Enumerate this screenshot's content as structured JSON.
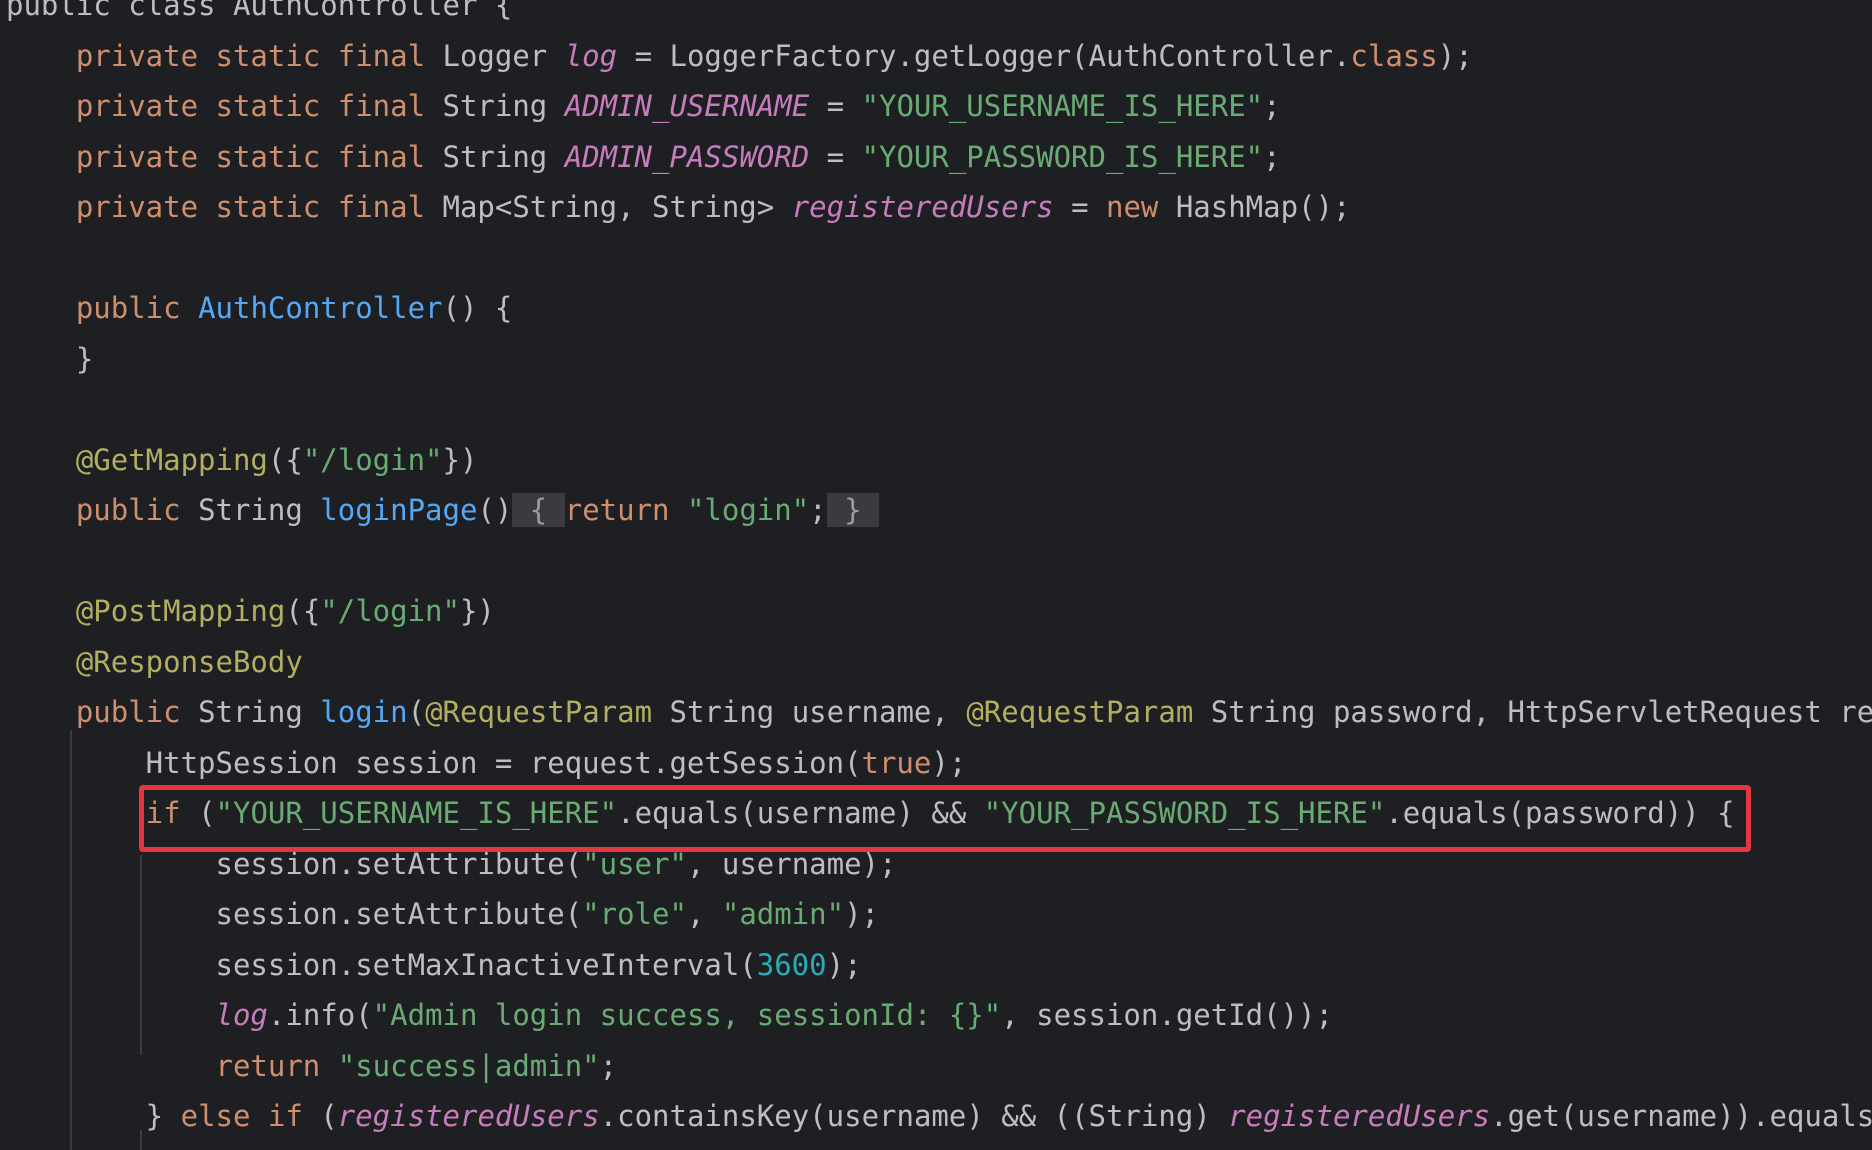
{
  "code": {
    "lines": [
      [
        {
          "t": "public class AuthController {",
          "c": "plain"
        }
      ],
      [
        {
          "t": "    private static final ",
          "c": "kw"
        },
        {
          "t": "Logger ",
          "c": "plain"
        },
        {
          "t": "log",
          "c": "fld"
        },
        {
          "t": " = LoggerFactory.getLogger(AuthController.",
          "c": "plain"
        },
        {
          "t": "class",
          "c": "kw"
        },
        {
          "t": ");",
          "c": "plain"
        }
      ],
      [
        {
          "t": "    private static final ",
          "c": "kw"
        },
        {
          "t": "String ",
          "c": "plain"
        },
        {
          "t": "ADMIN_USERNAME",
          "c": "fld"
        },
        {
          "t": " = ",
          "c": "plain"
        },
        {
          "t": "\"YOUR_USERNAME_IS_HERE\"",
          "c": "str"
        },
        {
          "t": ";",
          "c": "plain"
        }
      ],
      [
        {
          "t": "    private static final ",
          "c": "kw"
        },
        {
          "t": "String ",
          "c": "plain"
        },
        {
          "t": "ADMIN_PASSWORD",
          "c": "fld"
        },
        {
          "t": " = ",
          "c": "plain"
        },
        {
          "t": "\"YOUR_PASSWORD_IS_HERE\"",
          "c": "str"
        },
        {
          "t": ";",
          "c": "plain"
        }
      ],
      [
        {
          "t": "    private static final ",
          "c": "kw"
        },
        {
          "t": "Map<String, String> ",
          "c": "plain"
        },
        {
          "t": "registeredUsers",
          "c": "fld"
        },
        {
          "t": " = ",
          "c": "plain"
        },
        {
          "t": "new ",
          "c": "kw"
        },
        {
          "t": "HashMap();",
          "c": "plain"
        }
      ],
      [],
      [
        {
          "t": "    public ",
          "c": "kw"
        },
        {
          "t": "AuthController",
          "c": "fn"
        },
        {
          "t": "() {",
          "c": "plain"
        }
      ],
      [
        {
          "t": "    }",
          "c": "plain"
        }
      ],
      [],
      [
        {
          "t": "    @GetMapping",
          "c": "anno"
        },
        {
          "t": "({",
          "c": "plain"
        },
        {
          "t": "\"/login\"",
          "c": "str"
        },
        {
          "t": "})",
          "c": "plain"
        }
      ],
      [
        {
          "t": "    public ",
          "c": "kw"
        },
        {
          "t": "String ",
          "c": "plain"
        },
        {
          "t": "loginPage",
          "c": "fn"
        },
        {
          "t": "()",
          "c": "plain"
        },
        {
          "t": " { ",
          "c": "fold"
        },
        {
          "t": "return ",
          "c": "kw"
        },
        {
          "t": "\"login\"",
          "c": "str"
        },
        {
          "t": ";",
          "c": "plain"
        },
        {
          "t": " } ",
          "c": "fold"
        }
      ],
      [],
      [
        {
          "t": "    @PostMapping",
          "c": "anno"
        },
        {
          "t": "({",
          "c": "plain"
        },
        {
          "t": "\"/login\"",
          "c": "str"
        },
        {
          "t": "})",
          "c": "plain"
        }
      ],
      [
        {
          "t": "    @ResponseBody",
          "c": "anno"
        }
      ],
      [
        {
          "t": "    public ",
          "c": "kw"
        },
        {
          "t": "String ",
          "c": "plain"
        },
        {
          "t": "login",
          "c": "fn"
        },
        {
          "t": "(",
          "c": "plain"
        },
        {
          "t": "@RequestParam ",
          "c": "anno"
        },
        {
          "t": "String username, ",
          "c": "plain"
        },
        {
          "t": "@RequestParam ",
          "c": "anno"
        },
        {
          "t": "String password, HttpServletRequest re",
          "c": "plain"
        }
      ],
      [
        {
          "t": "        HttpSession session = request.getSession(",
          "c": "plain"
        },
        {
          "t": "true",
          "c": "kw"
        },
        {
          "t": ");",
          "c": "plain"
        }
      ],
      [
        {
          "t": "        if ",
          "c": "kw"
        },
        {
          "t": "(",
          "c": "plain"
        },
        {
          "t": "\"YOUR_USERNAME_IS_HERE\"",
          "c": "str"
        },
        {
          "t": ".equals(username) && ",
          "c": "plain"
        },
        {
          "t": "\"YOUR_PASSWORD_IS_HERE\"",
          "c": "str"
        },
        {
          "t": ".equals(password)) {",
          "c": "plain"
        }
      ],
      [
        {
          "t": "            session.setAttribute(",
          "c": "plain"
        },
        {
          "t": "\"user\"",
          "c": "str"
        },
        {
          "t": ", username);",
          "c": "plain"
        }
      ],
      [
        {
          "t": "            session.setAttribute(",
          "c": "plain"
        },
        {
          "t": "\"role\"",
          "c": "str"
        },
        {
          "t": ", ",
          "c": "plain"
        },
        {
          "t": "\"admin\"",
          "c": "str"
        },
        {
          "t": ");",
          "c": "plain"
        }
      ],
      [
        {
          "t": "            session.setMaxInactiveInterval(",
          "c": "plain"
        },
        {
          "t": "3600",
          "c": "num"
        },
        {
          "t": ");",
          "c": "plain"
        }
      ],
      [
        {
          "t": "            ",
          "c": "plain"
        },
        {
          "t": "log",
          "c": "fld"
        },
        {
          "t": ".info(",
          "c": "plain"
        },
        {
          "t": "\"Admin login success, sessionId: {}\"",
          "c": "str"
        },
        {
          "t": ", session.getId());",
          "c": "plain"
        }
      ],
      [
        {
          "t": "            return ",
          "c": "kw"
        },
        {
          "t": "\"success|admin\"",
          "c": "str"
        },
        {
          "t": ";",
          "c": "plain"
        }
      ],
      [
        {
          "t": "        } ",
          "c": "plain"
        },
        {
          "t": "else if ",
          "c": "kw"
        },
        {
          "t": "(",
          "c": "plain"
        },
        {
          "t": "registeredUsers",
          "c": "fld"
        },
        {
          "t": ".containsKey(username) && ((String) ",
          "c": "plain"
        },
        {
          "t": "registeredUsers",
          "c": "fld"
        },
        {
          "t": ".get(username)).equals",
          "c": "plain"
        }
      ]
    ]
  },
  "colors": {
    "background": "#1e1f22",
    "keyword": "#cf8e6d",
    "string": "#6aab73",
    "annotation": "#b3ae60",
    "method": "#56a8f5",
    "field": "#c77dbb",
    "number": "#2aacb8",
    "plain": "#bcbec4",
    "highlight_box": "#e5373f"
  }
}
